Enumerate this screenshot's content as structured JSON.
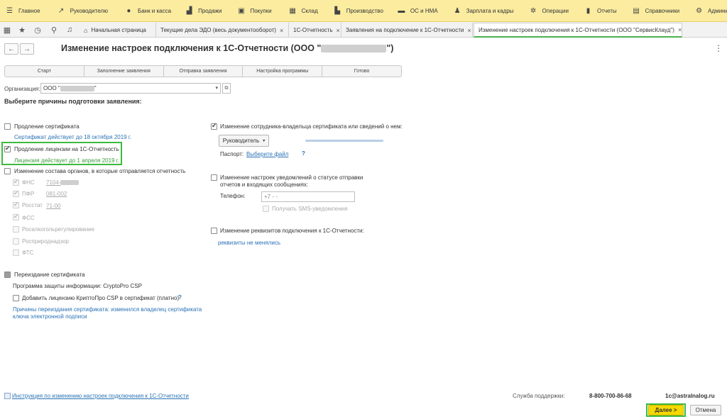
{
  "topmenu": {
    "items": [
      {
        "label": "Главное",
        "icon": "list-icon"
      },
      {
        "label": "Руководителю",
        "icon": "chart-trend-icon"
      },
      {
        "label": "Банк и касса",
        "icon": "bank-icon"
      },
      {
        "label": "Продажи",
        "icon": "bag-icon"
      },
      {
        "label": "Покупки",
        "icon": "cart-icon"
      },
      {
        "label": "Склад",
        "icon": "warehouse-icon"
      },
      {
        "label": "Производство",
        "icon": "factory-icon"
      },
      {
        "label": "ОС и НМА",
        "icon": "truck-icon"
      },
      {
        "label": "Зарплата и кадры",
        "icon": "person-icon"
      },
      {
        "label": "Операции",
        "icon": "gears-icon"
      },
      {
        "label": "Отчеты",
        "icon": "bar-chart-icon"
      },
      {
        "label": "Справочники",
        "icon": "book-icon"
      },
      {
        "label": "Администрир",
        "icon": "settings-icon"
      }
    ]
  },
  "tabs": [
    {
      "label": "Начальная страница"
    },
    {
      "label": "Текущие дела ЭДО (весь документооборот)"
    },
    {
      "label": "1С-Отчетность"
    },
    {
      "label": "Заявления на подключение к 1С-Отчетности"
    },
    {
      "label": "Изменение настроек подключения к 1С-Отчетности (ООО \"СервисКлауд\")"
    }
  ],
  "header": {
    "title_prefix": "Изменение настроек подключения к 1С-Отчетности (ООО \"",
    "title_suffix": "\")"
  },
  "steps": [
    "Старт",
    "Заполнение заявления",
    "Отправка заявления",
    "Настройка программы",
    "Готово"
  ],
  "organization": {
    "label": "Организация:",
    "value_prefix": "ООО \"",
    "value_suffix": "\""
  },
  "section_title": "Выберите причины подготовки заявления:",
  "left": {
    "renew_cert": "Продление сертификата",
    "renew_cert_note": "Сертификат действует до 18 октября 2019 г.",
    "renew_license": "Продление лицензии на 1С-Отчетность",
    "renew_license_note": "Лицензия действует до 1 апреля 2019 г.",
    "change_bodies": "Изменение состава органов, в которые отправляется отчетность",
    "bodies": [
      {
        "name": "ФНС",
        "code": "7104-"
      },
      {
        "name": "ПФР",
        "code": "081-002"
      },
      {
        "name": "Росстат",
        "code": "71-00"
      },
      {
        "name": "ФСС",
        "code": ""
      },
      {
        "name": "Росалкогольрегулирование",
        "code": ""
      },
      {
        "name": "Росприроднадзор",
        "code": ""
      },
      {
        "name": "ФТС",
        "code": ""
      }
    ],
    "reissue": "Переиздание сертификата",
    "protection": "Программа защиты информации: CryptoPro CSP",
    "add_license": "Добавить лицензию КриптоПро CSP в сертификат (платно)",
    "add_license_help": "?",
    "reissue_reason_line1": "Причины переиздания сертификата: изменился владелец сертификата",
    "reissue_reason_line2": "ключа электронной подписи"
  },
  "right": {
    "change_owner": "Изменение сотрудника-владельца сертификата или сведений о нем:",
    "role_value": "Руководитель",
    "passport_label": "Паспорт:",
    "passport_link": "Выберите файл",
    "passport_help": "?",
    "notify_line1": "Изменение настроек уведомлений о статусе отправки",
    "notify_line2": "отчетов и входящих сообщениях:",
    "phone_label": "Телефон:",
    "phone_value": "+7       -   -",
    "sms_label": "Получать SMS-уведомления",
    "details": "Изменение реквизитов подключения к 1С-Отчетности:",
    "details_note": "реквизиты не менялись"
  },
  "footer": {
    "instruction_link": "Инструкция по изменению настроек подключения к 1С-Отчетности",
    "support_label": "Служба поддержки:",
    "phone": "8-800-700-86-68",
    "email": "1c@astralnalog.ru",
    "next": "Далее  >",
    "cancel": "Отмена"
  },
  "colors": {
    "menu_bg": "#fbeca0",
    "accent": "#3cba3c",
    "link": "#2a72b5",
    "next_button": "#f5d900"
  }
}
